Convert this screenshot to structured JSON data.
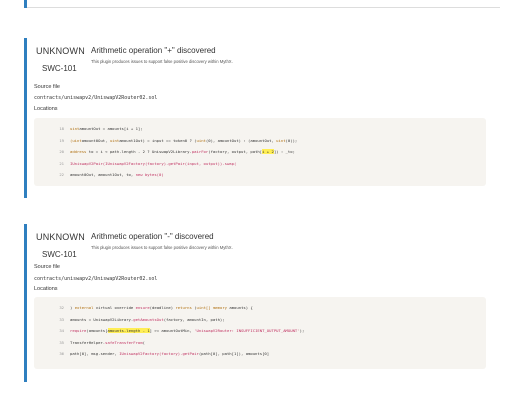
{
  "issues": [
    {
      "severity": "UNKNOWN",
      "title": "Arithmetic operation \"+\" discovered",
      "swc": "SWC-101",
      "description": "This plugin produces issues to support false positive discovery within MythX.",
      "source_label": "Source file",
      "file": "contracts/uniswapv2/UniswapV2Router02.sol",
      "locations_label": "Locations",
      "lines": [
        {
          "num": "18",
          "parts": [
            [
              "kw",
              "uint"
            ],
            [
              "",
              "amountOut = amounts[i + 1];"
            ]
          ]
        },
        {
          "num": "19",
          "parts": [
            [
              "kw",
              "(uint"
            ],
            [
              "",
              "amount0Out, "
            ],
            [
              "kw",
              "uint"
            ],
            [
              "",
              "amount1Out) = input == token0 ? ("
            ],
            [
              "kw",
              "uint"
            ],
            [
              "",
              "(0), amountOut) : (amountOut, "
            ],
            [
              "kw",
              "uint"
            ],
            [
              "",
              "(0));"
            ]
          ]
        },
        {
          "num": "20",
          "parts": [
            [
              "kw",
              "address"
            ],
            [
              "",
              " to = i < path.length - 2 ? UniswapV2Library."
            ],
            [
              "fn",
              "pairFor"
            ],
            [
              "",
              "(factory, output, path["
            ],
            [
              "hl",
              "i + 2"
            ],
            [
              "",
              "]) : _to;"
            ]
          ]
        },
        {
          "num": "21",
          "parts": [
            [
              "fn",
              "IUniswapV2Pair(IUniswapV2Factory(factory).getPair(input, output)).swap("
            ],
            [
              "",
              ""
            ]
          ]
        },
        {
          "num": "22",
          "parts": [
            [
              "",
              "amount0Out, amount1Out, to, "
            ],
            [
              "fn",
              "new bytes(0)"
            ]
          ]
        }
      ]
    },
    {
      "severity": "UNKNOWN",
      "title": "Arithmetic operation \"-\" discovered",
      "swc": "SWC-101",
      "description": "This plugin produces issues to support false positive discovery within MythX.",
      "source_label": "Source file",
      "file": "contracts/uniswapv2/UniswapV2Router02.sol",
      "locations_label": "Locations",
      "lines": [
        {
          "num": "32",
          "parts": [
            [
              "",
              ") "
            ],
            [
              "kw",
              "external"
            ],
            [
              "",
              " virtual override "
            ],
            [
              "fn",
              "ensure"
            ],
            [
              "",
              "(deadline) "
            ],
            [
              "kw",
              "returns"
            ],
            [
              "",
              " ("
            ],
            [
              "kw",
              "uint[]"
            ],
            [
              "",
              " "
            ],
            [
              "kw",
              "memory"
            ],
            [
              "",
              " amounts) {"
            ]
          ]
        },
        {
          "num": "33",
          "parts": [
            [
              "",
              "amounts = UniswapV2Library."
            ],
            [
              "fn",
              "getAmountsOut"
            ],
            [
              "",
              "(factory, amountIn, path);"
            ]
          ]
        },
        {
          "num": "34",
          "parts": [
            [
              "fn",
              "require"
            ],
            [
              "",
              "(amounts["
            ],
            [
              "hl",
              "amounts.length - 1"
            ],
            [
              "",
              "] >= amountOutMin, "
            ],
            [
              "fn",
              "'UniswapV2Router: INSUFFICIENT_OUTPUT_AMOUNT'"
            ],
            [
              "",
              ");"
            ]
          ]
        },
        {
          "num": "35",
          "parts": [
            [
              "",
              "TransferHelper."
            ],
            [
              "fn",
              "safeTransferFrom"
            ],
            [
              "",
              "("
            ]
          ]
        },
        {
          "num": "36",
          "parts": [
            [
              "",
              "path[0], msg.sender, "
            ],
            [
              "fn",
              "IUniswapV2Factory(factory).getPair"
            ],
            [
              "",
              "(path[0], path[1]), amounts[0]"
            ]
          ]
        }
      ]
    }
  ]
}
